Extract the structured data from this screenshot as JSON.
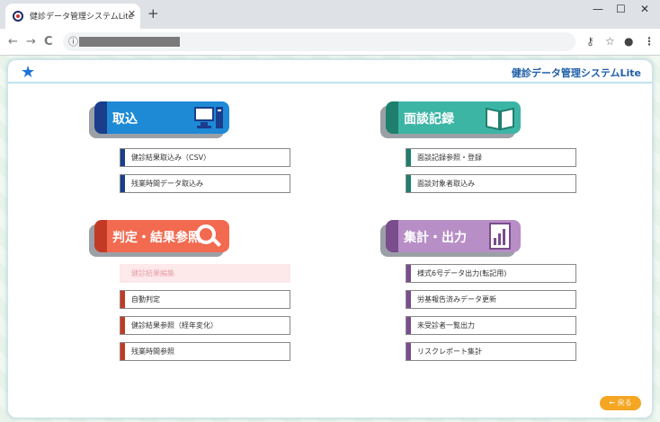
{
  "browser": {
    "tab_title": "健診データ管理システムLite",
    "tab_close": "✕",
    "new_tab": "+",
    "win_min": "—",
    "win_max": "☐",
    "win_close": "✕",
    "nav_back": "←",
    "nav_forward": "→",
    "nav_reload": "C",
    "url_info": "ⓘ",
    "key_icon": "⚷",
    "star_icon": "☆",
    "profile_icon": "●",
    "menu_icon": "⋮"
  },
  "header": {
    "logo": "★",
    "title": "健診データ管理システムLite"
  },
  "sections": {
    "torikomi": {
      "title": "取込",
      "color": "#1e8ad6",
      "stripe": "#1a3d8c",
      "items": [
        "健診結果取込み（CSV）",
        "残業時間データ取込み"
      ]
    },
    "mendan": {
      "title": "面談記録",
      "color": "#3db5a5",
      "stripe": "#1f7f6e",
      "items": [
        "面談記録参照・登録",
        "面談対象者取込み"
      ]
    },
    "hantei": {
      "title": "判定・結果参照",
      "color": "#f26a50",
      "stripe": "#c23a25",
      "items": [
        "健診結果編集",
        "自動判定",
        "健診結果参照（経年変化）",
        "残業時間参照"
      ]
    },
    "shukei": {
      "title": "集計・出力",
      "color": "#b78ec6",
      "stripe": "#7a4d8d",
      "items": [
        "様式6号データ出力(転記用)",
        "労基報告済みデータ更新",
        "未受診者一覧出力",
        "リスクレポート集計"
      ]
    }
  },
  "back_button": "← 戻る"
}
